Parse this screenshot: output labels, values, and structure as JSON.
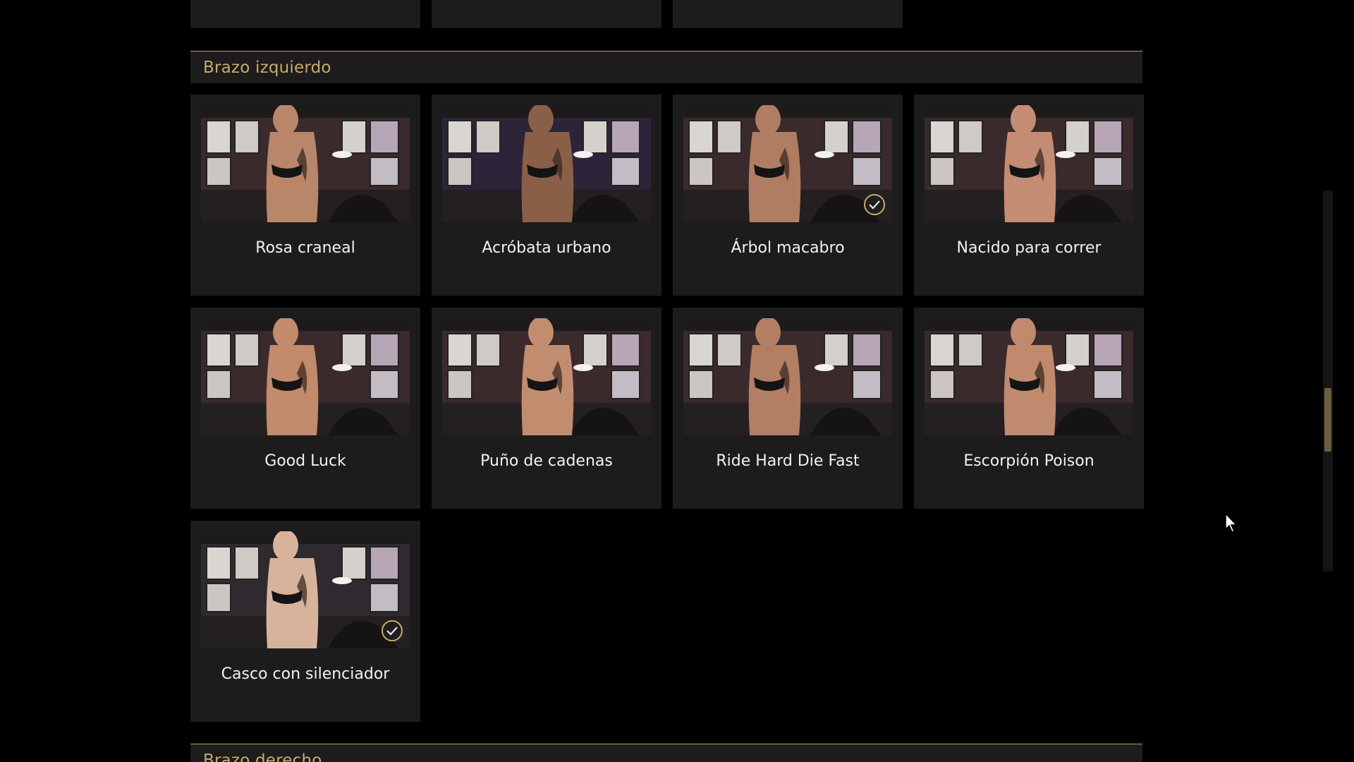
{
  "sections": {
    "left_arm": {
      "title": "Brazo izquierdo"
    },
    "right_arm": {
      "title": "Brazo derecho"
    }
  },
  "items": [
    {
      "label": "Rosa craneal",
      "selected": false,
      "skin": "#b9866a",
      "wall": "#3a2a2c"
    },
    {
      "label": "Acróbata urbano",
      "selected": false,
      "skin": "#8a5f48",
      "wall": "#2c2438"
    },
    {
      "label": "Árbol macabro",
      "selected": true,
      "skin": "#b07d62",
      "wall": "#3a2a2c"
    },
    {
      "label": "Nacido para correr",
      "selected": false,
      "skin": "#c48d73",
      "wall": "#3a2a2c"
    },
    {
      "label": "Good Luck",
      "selected": false,
      "skin": "#c18b6c",
      "wall": "#3a2a2c"
    },
    {
      "label": "Puño de cadenas",
      "selected": false,
      "skin": "#c28d6f",
      "wall": "#3a2a2c"
    },
    {
      "label": "Ride Hard Die Fast",
      "selected": false,
      "skin": "#b27e64",
      "wall": "#3a2a2c"
    },
    {
      "label": "Escorpión Poison",
      "selected": false,
      "skin": "#c08a6e",
      "wall": "#3a2a2c"
    },
    {
      "label": "Casco con silenciador",
      "selected": true,
      "skin": "#d8b39c",
      "wall": "#2f2a30"
    }
  ],
  "colors": {
    "accent": "#c8aa6e",
    "card": "#1c1c1c",
    "background": "#000000"
  }
}
